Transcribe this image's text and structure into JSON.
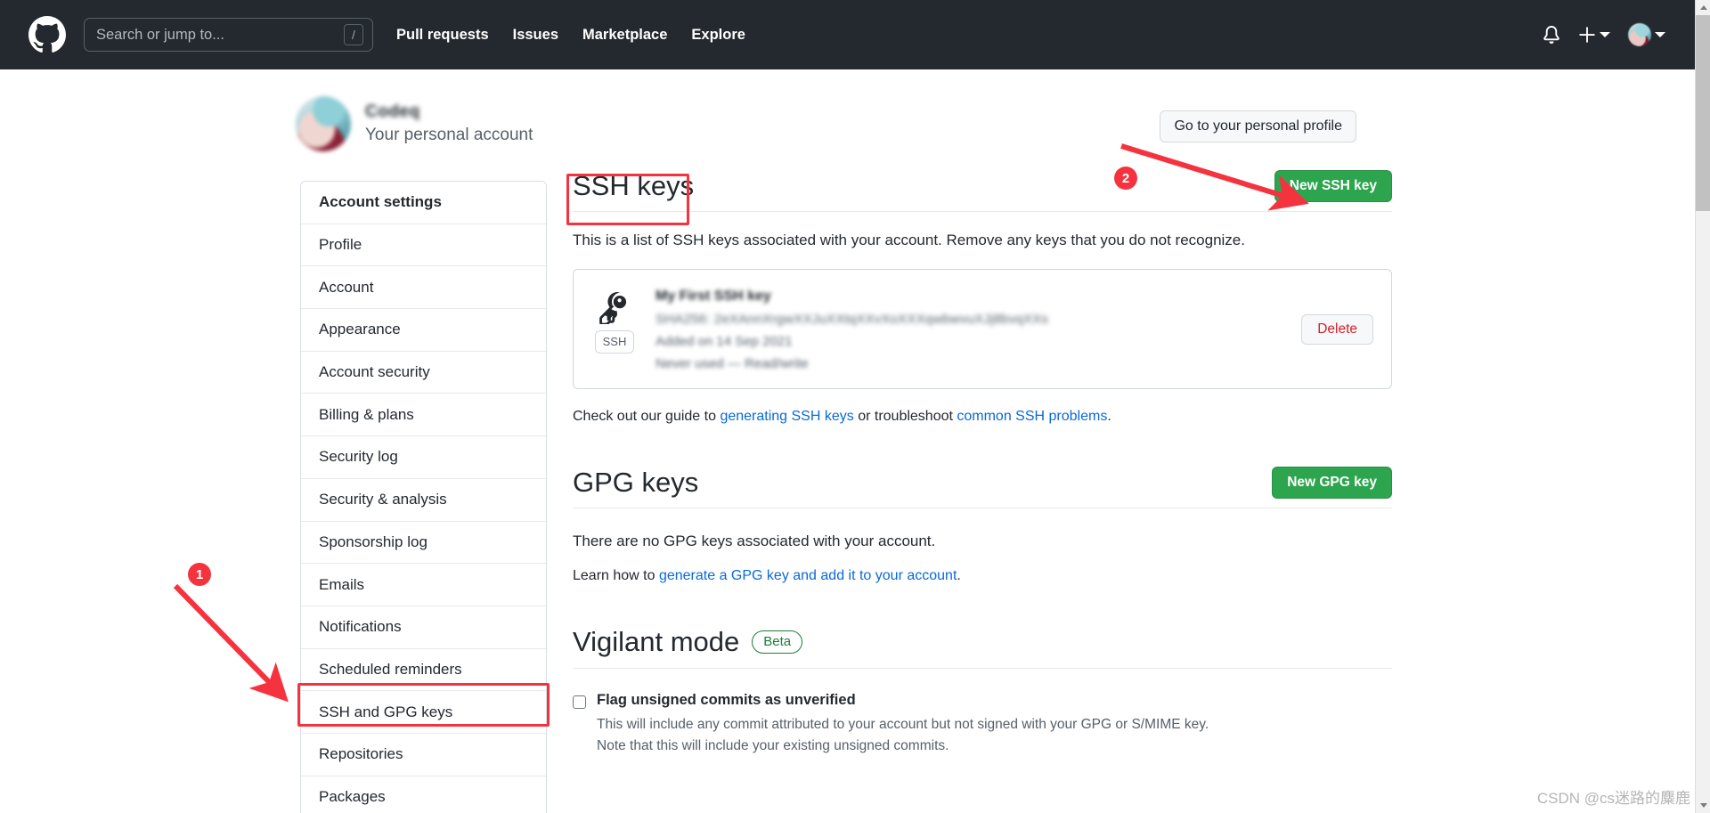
{
  "header": {
    "logo_icon": "github-mark-icon",
    "search": {
      "placeholder": "Search or jump to...",
      "value": "",
      "shortcut": "/"
    },
    "nav": [
      {
        "label": "Pull requests"
      },
      {
        "label": "Issues"
      },
      {
        "label": "Marketplace"
      },
      {
        "label": "Explore"
      }
    ],
    "right": {
      "notifications_icon": "bell-icon",
      "create_new_icon": "plus-icon",
      "create_new_caret_icon": "chevron-down-icon",
      "avatar_icon": "avatar",
      "avatar_caret_icon": "chevron-down-icon"
    },
    "background_color": "#24292f"
  },
  "profile": {
    "name": "Codeq",
    "subtitle": "Your personal account",
    "avatar_icon": "avatar",
    "go_to_profile_label": "Go to your personal profile"
  },
  "sidebar": {
    "items": [
      {
        "label": "Account settings",
        "is_header": true
      },
      {
        "label": "Profile",
        "is_header": false
      },
      {
        "label": "Account",
        "is_header": false
      },
      {
        "label": "Appearance",
        "is_header": false
      },
      {
        "label": "Account security",
        "is_header": false
      },
      {
        "label": "Billing & plans",
        "is_header": false
      },
      {
        "label": "Security log",
        "is_header": false
      },
      {
        "label": "Security & analysis",
        "is_header": false
      },
      {
        "label": "Sponsorship log",
        "is_header": false
      },
      {
        "label": "Emails",
        "is_header": false
      },
      {
        "label": "Notifications",
        "is_header": false
      },
      {
        "label": "Scheduled reminders",
        "is_header": false
      },
      {
        "label": "SSH and GPG keys",
        "is_header": false
      },
      {
        "label": "Repositories",
        "is_header": false
      },
      {
        "label": "Packages",
        "is_header": false
      }
    ]
  },
  "ssh_section": {
    "title": "SSH keys",
    "new_key_button": "New SSH key",
    "description": "This is a list of SSH keys associated with your account. Remove any keys that you do not recognize.",
    "key": {
      "icon": "key-icon",
      "protocol_tag": "SSH",
      "title": "My First SSH key",
      "fingerprint": "SHA256: 2eXAnnXrgwXXJuXXtqXXvXoXXXqwbwvuXJj8bvqXXs",
      "added": "Added on 14 Sep 2021",
      "last_used": "Never used — Read/write",
      "delete_button": "Delete"
    },
    "guide": {
      "prefix": "Check out our guide to ",
      "link1": "generating SSH keys",
      "middle": " or troubleshoot ",
      "link2": "common SSH problems",
      "suffix": "."
    }
  },
  "gpg_section": {
    "title": "GPG keys",
    "new_key_button": "New GPG key",
    "empty_text": "There are no GPG keys associated with your account.",
    "learn_prefix": "Learn how to ",
    "learn_link": "generate a GPG key and add it to your account",
    "learn_suffix": "."
  },
  "vigilant_section": {
    "title": "Vigilant mode",
    "badge": "Beta",
    "checkbox_checked": false,
    "checkbox_label": "Flag unsigned commits as unverified",
    "sub_line1": "This will include any commit attributed to your account but not signed with your GPG or S/MIME key.",
    "sub_line2": "Note that this will include your existing unsigned commits."
  },
  "annotations": {
    "color": "#f5333f",
    "marker_1": "1",
    "marker_2": "2",
    "box_1_target": "sidebar-item-ssh-and-gpg-keys",
    "box_2_target": "ssh-keys-title",
    "arrow_1_target": "sidebar-item-ssh-and-gpg-keys",
    "arrow_2_target": "new-ssh-key-button"
  },
  "watermark": {
    "text": "CSDN @cs迷路的麋鹿"
  }
}
